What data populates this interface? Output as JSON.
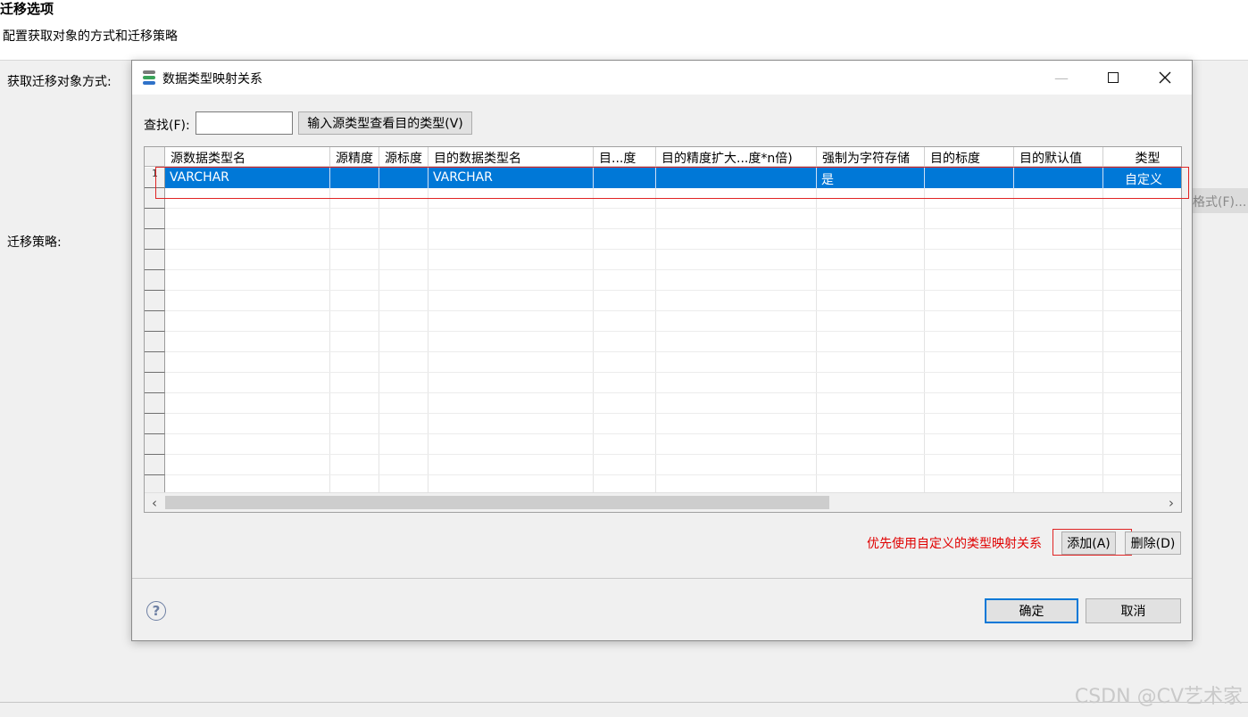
{
  "page": {
    "title": "迁移选项",
    "subtitle": "配置获取对象的方式和迁移策略",
    "label_fetch": "获取迁移对象方式:",
    "label_strategy": "迁移策略:",
    "format_button": "格式(F)..."
  },
  "watermark": "CSDN @CV艺术家",
  "dialog": {
    "title": "数据类型映射关系",
    "find_label": "查找(F):",
    "find_value": "",
    "lookup_button": "输入源类型查看目的类型(V)",
    "columns": [
      "源数据类型名",
      "源精度",
      "源标度",
      "目的数据类型名",
      "目...度",
      "目的精度扩大...度*n倍)",
      "强制为字符存储",
      "目的标度",
      "目的默认值",
      "类型"
    ],
    "rows": [
      {
        "row_marker": "1",
        "src_type": "VARCHAR",
        "src_precision": "",
        "src_scale": "",
        "dst_type": "VARCHAR",
        "dst_len": "",
        "dst_precision_expand": "",
        "force_char": "是",
        "dst_scale": "",
        "dst_default": "",
        "kind": "自定义"
      }
    ],
    "note": "优先使用自定义的类型映射关系",
    "add_button": "添加(A)",
    "delete_button": "删除(D)",
    "ok_button": "确定",
    "cancel_button": "取消"
  },
  "colors": {
    "selection": "#0078d7",
    "highlight_box": "#e02424",
    "note_text": "#e00000"
  },
  "icons": [
    "app-icon",
    "minimize-icon",
    "maximize-icon",
    "close-icon",
    "help-icon",
    "scroll-left-icon",
    "scroll-right-icon"
  ]
}
